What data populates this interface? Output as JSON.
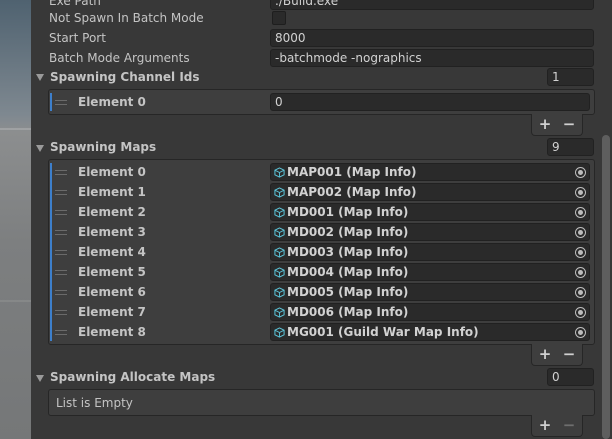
{
  "inspector": {
    "exe_path": {
      "label": "Exe Path",
      "value": "./Build.exe"
    },
    "not_spawn_batch": {
      "label": "Not Spawn In Batch Mode",
      "checked": false
    },
    "start_port": {
      "label": "Start Port",
      "value": "8000"
    },
    "batch_args": {
      "label": "Batch Mode Arguments",
      "value": "-batchmode -nographics"
    }
  },
  "channel_ids": {
    "label": "Spawning Channel Ids",
    "size": "1",
    "elements": [
      {
        "label": "Element 0",
        "value": "0"
      }
    ],
    "add": "+",
    "remove": "−"
  },
  "maps": {
    "label": "Spawning Maps",
    "size": "9",
    "elements": [
      {
        "label": "Element 0",
        "value": "MAP001 (Map Info)"
      },
      {
        "label": "Element 1",
        "value": "MAP002 (Map Info)"
      },
      {
        "label": "Element 2",
        "value": "MD001 (Map Info)"
      },
      {
        "label": "Element 3",
        "value": "MD002 (Map Info)"
      },
      {
        "label": "Element 4",
        "value": "MD003 (Map Info)"
      },
      {
        "label": "Element 5",
        "value": "MD004 (Map Info)"
      },
      {
        "label": "Element 6",
        "value": "MD005 (Map Info)"
      },
      {
        "label": "Element 7",
        "value": "MD006 (Map Info)"
      },
      {
        "label": "Element 8",
        "value": "MG001 (Guild War Map Info)"
      }
    ],
    "add": "+",
    "remove": "−"
  },
  "allocate_maps": {
    "label": "Spawning Allocate Maps",
    "size": "0",
    "empty_text": "List is Empty",
    "add": "+",
    "remove": "−"
  },
  "colors": {
    "accent": "#3d7fcb",
    "panel": "#383838",
    "field": "#2a2a2a"
  },
  "icons": {
    "object": "scriptable-object-icon",
    "picker": "object-picker-icon",
    "foldout": "foldout-arrow-icon",
    "handle": "drag-handle-icon"
  }
}
